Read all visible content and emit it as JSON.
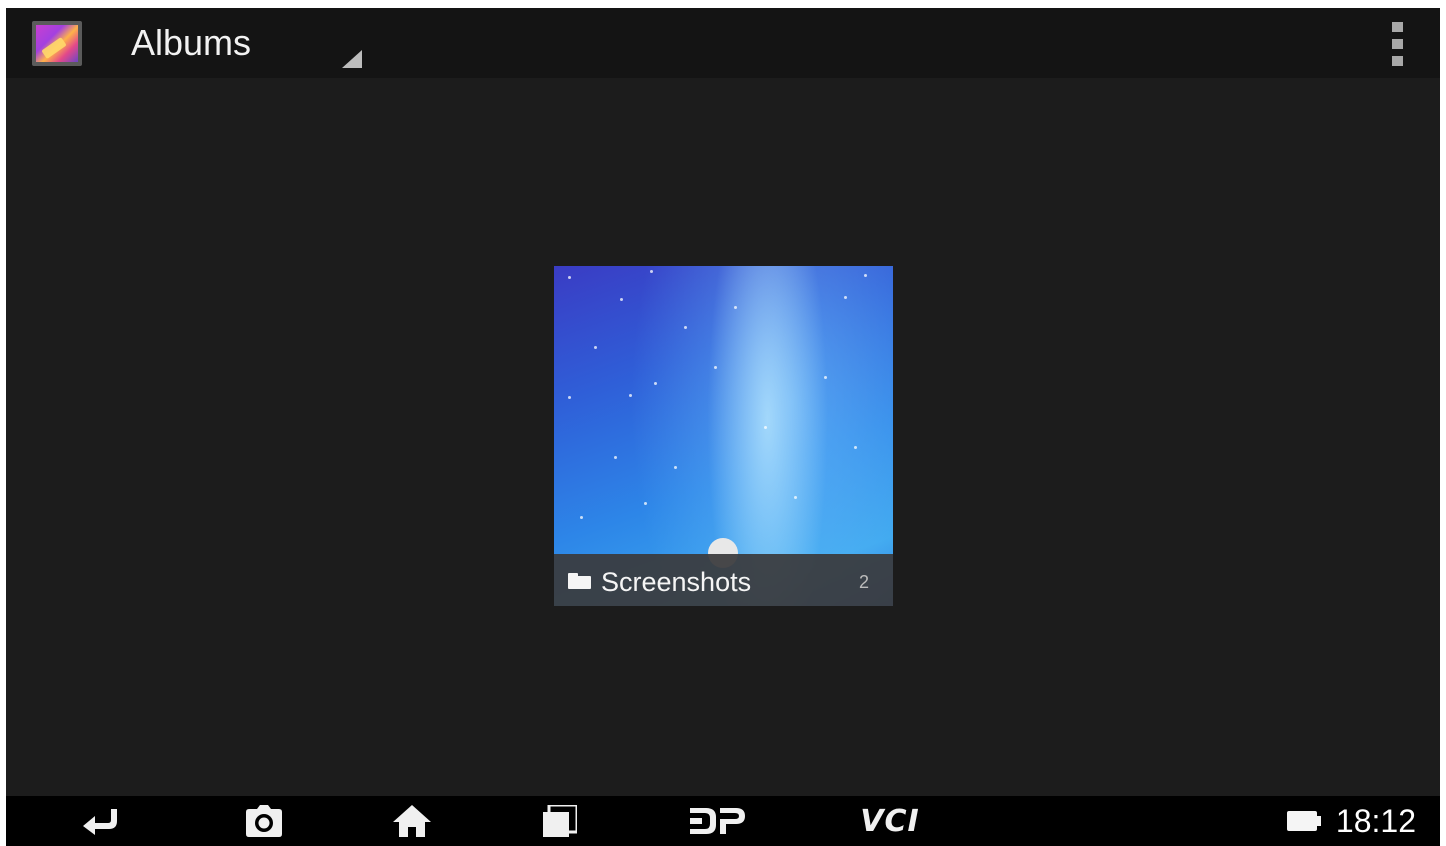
{
  "action_bar": {
    "title": "Albums",
    "app_icon": "gallery-icon",
    "overflow_icon": "overflow-menu-icon"
  },
  "albums": [
    {
      "name": "Screenshots",
      "count": "2",
      "icon": "folder-icon"
    }
  ],
  "nav_bar": {
    "buttons": [
      {
        "icon": "back-icon"
      },
      {
        "icon": "camera-icon"
      },
      {
        "icon": "home-icon"
      },
      {
        "icon": "recent-apps-icon"
      },
      {
        "icon": "dp-icon"
      },
      {
        "icon": "vci-icon",
        "label": "VCI"
      }
    ],
    "status": {
      "battery_icon": "battery-icon",
      "time": "18:12"
    }
  },
  "colors": {
    "screen_background": "#1c1c1c",
    "action_bar_background": "#141414",
    "nav_bar_background": "#000000",
    "label_strip": "#3a3a3c"
  }
}
